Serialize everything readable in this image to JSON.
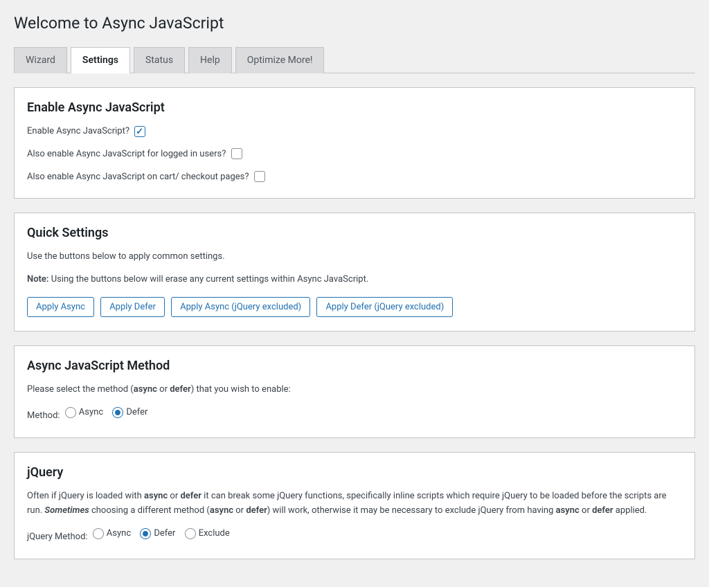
{
  "page_title": "Welcome to Async JavaScript",
  "tabs": {
    "wizard": "Wizard",
    "settings": "Settings",
    "status": "Status",
    "help": "Help",
    "optimize": "Optimize More!"
  },
  "enable_panel": {
    "heading": "Enable Async JavaScript",
    "opt1_label": "Enable Async JavaScript?",
    "opt2_label": "Also enable Async JavaScript for logged in users?",
    "opt3_label": "Also enable Async JavaScript on cart/ checkout pages?"
  },
  "quick_panel": {
    "heading": "Quick Settings",
    "desc": "Use the buttons below to apply common settings.",
    "note_label": "Note:",
    "note_text": " Using the buttons below will erase any current settings within Async JavaScript.",
    "btn1": "Apply Async",
    "btn2": "Apply Defer",
    "btn3": "Apply Async (jQuery excluded)",
    "btn4": "Apply Defer (jQuery excluded)"
  },
  "method_panel": {
    "heading": "Async JavaScript Method",
    "desc_pre": "Please select the method (",
    "desc_async": "async",
    "desc_or": " or ",
    "desc_defer": "defer",
    "desc_post": ") that you wish to enable:",
    "label": "Method:",
    "opt_async": "Async",
    "opt_defer": "Defer"
  },
  "jquery_panel": {
    "heading": "jQuery",
    "desc_p1": "Often if jQuery is loaded with ",
    "desc_async": "async",
    "desc_or1": " or ",
    "desc_defer": "defer",
    "desc_p2": " it can break some jQuery functions, specifically inline scripts which require jQuery to be loaded before the scripts are run. ",
    "desc_sometimes": "Sometimes",
    "desc_p3": " choosing a different method (",
    "desc_async2": "async",
    "desc_or2": " or ",
    "desc_defer2": "defer",
    "desc_p4": ") will work, otherwise it may be necessary to exclude jQuery from having ",
    "desc_async3": "async",
    "desc_or3": " or ",
    "desc_defer3": "defer",
    "desc_p5": " applied.",
    "label": "jQuery Method:",
    "opt_async": "Async",
    "opt_defer": "Defer",
    "opt_exclude": "Exclude"
  }
}
